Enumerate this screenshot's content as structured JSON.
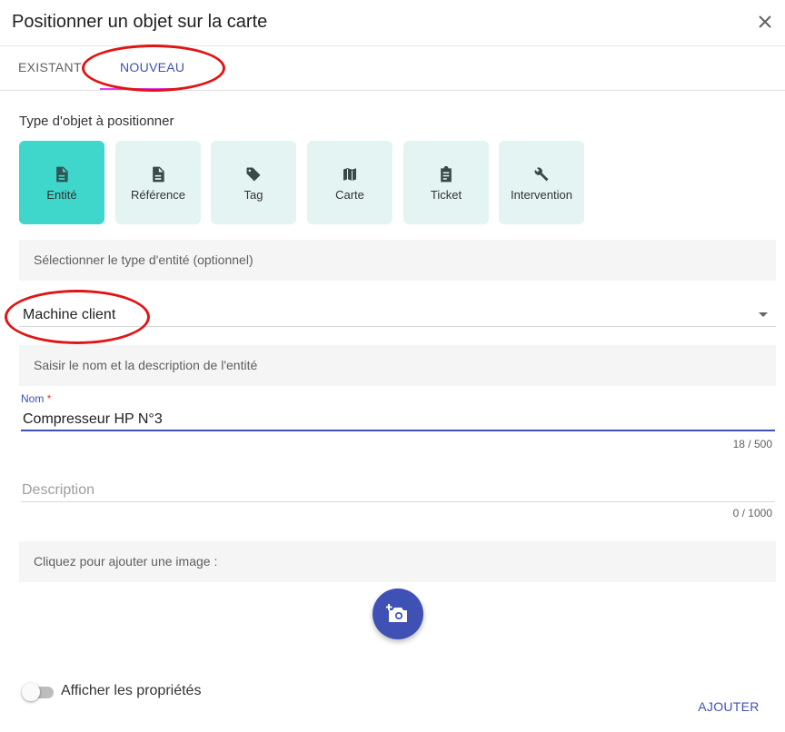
{
  "dialog": {
    "title": "Positionner un objet sur la carte"
  },
  "tabs": [
    {
      "label": "EXISTANT"
    },
    {
      "label": "NOUVEAU"
    }
  ],
  "object_type": {
    "label": "Type d'objet à positionner",
    "options": [
      {
        "label": "Entité",
        "icon": "document-icon",
        "selected": true
      },
      {
        "label": "Référence",
        "icon": "document-icon",
        "selected": false
      },
      {
        "label": "Tag",
        "icon": "tag-icon",
        "selected": false
      },
      {
        "label": "Carte",
        "icon": "map-icon",
        "selected": false
      },
      {
        "label": "Ticket",
        "icon": "clipboard-icon",
        "selected": false
      },
      {
        "label": "Intervention",
        "icon": "wrench-icon",
        "selected": false
      }
    ]
  },
  "entity_type": {
    "section_label": "Sélectionner le type d'entité (optionnel)",
    "selected_value": "Machine client"
  },
  "name_section": {
    "label": "Saisir le nom et la description de l'entité"
  },
  "name_field": {
    "label": "Nom",
    "required_marker": "*",
    "value": "Compresseur HP N°3",
    "counter": "18 / 500"
  },
  "description_field": {
    "placeholder": "Description",
    "counter": "0 / 1000"
  },
  "image": {
    "label": "Cliquez pour ajouter une image :"
  },
  "properties_toggle": {
    "label": "Afficher les propriétés",
    "on": false
  },
  "actions": {
    "add_label": "AJOUTER"
  },
  "colors": {
    "accent": "#3f51b5",
    "selected_type": "#3fd6cc",
    "type_card": "#e3f4f3",
    "annotation": "#e01515"
  }
}
